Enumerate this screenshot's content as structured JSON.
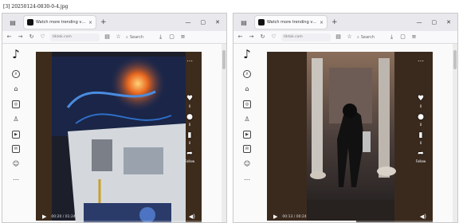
{
  "caption": "[3] 20250124-0830-0-4.jpg",
  "windows": [
    {
      "tab_title": "Watch more trending videos",
      "tab_close": "×",
      "new_tab": "+",
      "window_controls": [
        "—",
        "▢",
        "✕"
      ],
      "url": "tiktok.com",
      "search_placeholder": "Search",
      "sidebar_icons": [
        "home-icon",
        "search-icon",
        "explore-icon",
        "following-icon",
        "live-icon",
        "messages-icon",
        "profile-icon",
        "more-icon"
      ],
      "actions": {
        "like": "0",
        "comment": "0",
        "save": "0",
        "share": "Follow"
      },
      "time": "00:20 / 01:24",
      "progress": 0.24
    },
    {
      "tab_title": "Watch more trending videos",
      "tab_close": "×",
      "new_tab": "+",
      "window_controls": [
        "—",
        "▢",
        "✕"
      ],
      "url": "tiktok.com",
      "search_placeholder": "Search",
      "sidebar_icons": [
        "home-icon",
        "search-icon",
        "explore-icon",
        "following-icon",
        "live-icon",
        "messages-icon",
        "profile-icon",
        "more-icon"
      ],
      "actions": {
        "like": "0",
        "comment": "0",
        "save": "0",
        "share": "Follow"
      },
      "time": "00:13 / 00:24",
      "progress": 0.54
    }
  ]
}
